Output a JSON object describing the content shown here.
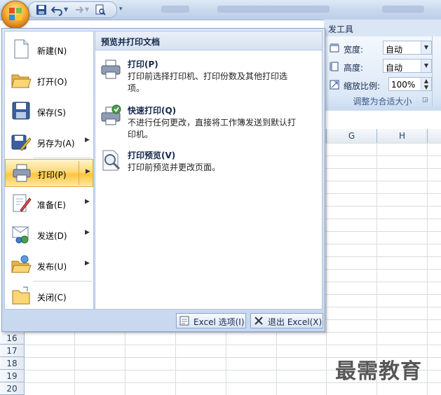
{
  "ribbon": {
    "tab_label": "发工具",
    "width_label": "宽度:",
    "width_value": "自动",
    "height_label": "高度:",
    "height_value": "自动",
    "scale_label": "缩放比例:",
    "scale_value": "100%",
    "group_title": "调整为合适大小"
  },
  "grid": {
    "columns": [
      "G",
      "H"
    ],
    "rows": [
      "16",
      "17",
      "18",
      "19",
      "20"
    ]
  },
  "menu": {
    "items": [
      {
        "label": "新建(N)",
        "icon": "new-document-icon",
        "has_submenu": false
      },
      {
        "label": "打开(O)",
        "icon": "open-folder-icon",
        "has_submenu": false
      },
      {
        "label": "保存(S)",
        "icon": "save-disk-icon",
        "has_submenu": false
      },
      {
        "label": "另存为(A)",
        "icon": "save-as-icon",
        "has_submenu": true
      },
      {
        "label": "打印(P)",
        "icon": "printer-icon",
        "has_submenu": true,
        "active": true
      },
      {
        "label": "准备(E)",
        "icon": "prepare-icon",
        "has_submenu": true
      },
      {
        "label": "发送(D)",
        "icon": "send-icon",
        "has_submenu": true
      },
      {
        "label": "发布(U)",
        "icon": "publish-icon",
        "has_submenu": true
      },
      {
        "label": "关闭(C)",
        "icon": "close-folder-icon",
        "has_submenu": false
      }
    ],
    "submenu_title": "预览并打印文档",
    "submenu": [
      {
        "title": "打印(P)",
        "desc": "打印前选择打印机、打印份数及其他打印选项。"
      },
      {
        "title": "快速打印(Q)",
        "desc": "不进行任何更改，直接将工作簿发送到默认打印机。"
      },
      {
        "title": "打印预览(V)",
        "desc": "打印前预览并更改页面。"
      }
    ],
    "options_button": "Excel 选项(I)",
    "exit_button": "退出 Excel(X)"
  },
  "watermark": "最需教育",
  "colors": {
    "accent": "#ffc53c",
    "frame": "#c8d8ee"
  }
}
